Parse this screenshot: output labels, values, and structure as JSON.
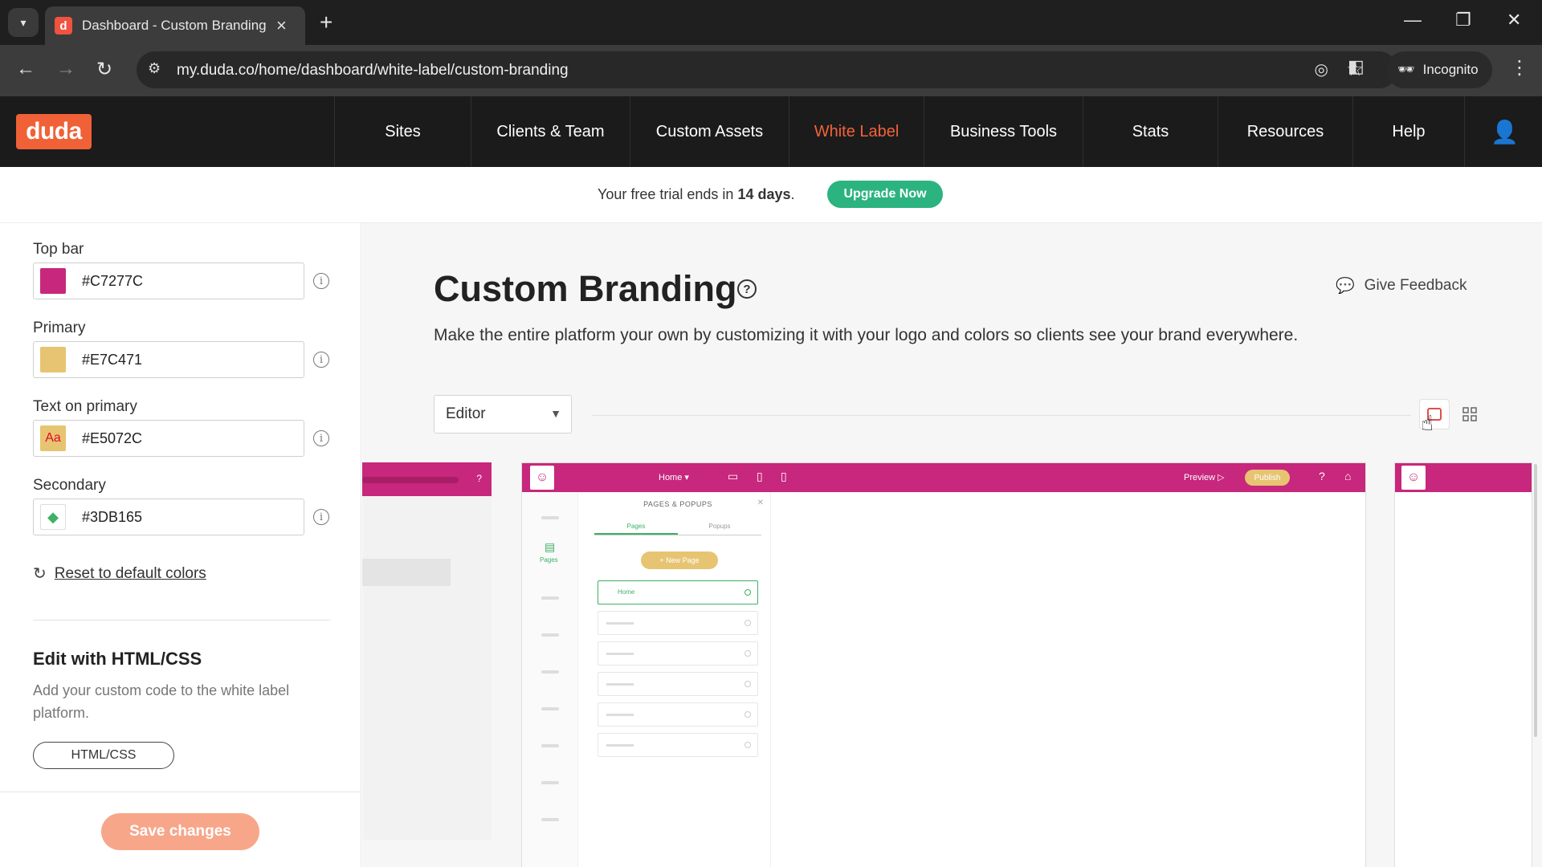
{
  "browser": {
    "tab_title": "Dashboard - Custom Branding |",
    "favicon_letter": "d",
    "url": "my.duda.co/home/dashboard/white-label/custom-branding",
    "incognito_label": "Incognito"
  },
  "app": {
    "logo": "duda",
    "nav": [
      {
        "label": "Sites"
      },
      {
        "label": "Clients & Team"
      },
      {
        "label": "Custom Assets"
      },
      {
        "label": "White Label",
        "active": true
      },
      {
        "label": "Business Tools"
      },
      {
        "label": "Stats"
      },
      {
        "label": "Resources"
      },
      {
        "label": "Help"
      }
    ]
  },
  "trial": {
    "text_before": "Your free trial ends in ",
    "days": "14 days",
    "text_after": ".",
    "upgrade_label": "Upgrade Now"
  },
  "colors": [
    {
      "label": "Top bar",
      "hex": "#C7277C",
      "swatch": "#C7277C"
    },
    {
      "label": "Primary",
      "hex": "#E7C471",
      "swatch": "#E7C471"
    },
    {
      "label": "Text on primary",
      "hex": "#E5072C",
      "swatch": "#E7C471",
      "swatch_text": "Aa"
    },
    {
      "label": "Secondary",
      "hex": "#3DB165",
      "swatch": "#FFFFFF",
      "swatch_icon_color": "#3DB165"
    }
  ],
  "reset_label": "Reset to default colors",
  "html_section": {
    "title": "Edit with HTML/CSS",
    "description": "Add your custom code to the white label platform.",
    "button": "HTML/CSS"
  },
  "save_label": "Save changes",
  "main": {
    "title": "Custom Branding",
    "feedback_label": "Give Feedback",
    "description": "Make the entire platform your own by customizing it with your logo and colors so clients see your brand everywhere.",
    "view_select": "Editor"
  },
  "preview": {
    "home_label": "Home",
    "preview_label": "Preview",
    "publish_label": "Publish",
    "panel_title": "PAGES & POPUPS",
    "tab_pages": "Pages",
    "tab_popups": "Popups",
    "new_page": "+ New Page",
    "row_home": "Home",
    "rail_pages": "Pages"
  }
}
